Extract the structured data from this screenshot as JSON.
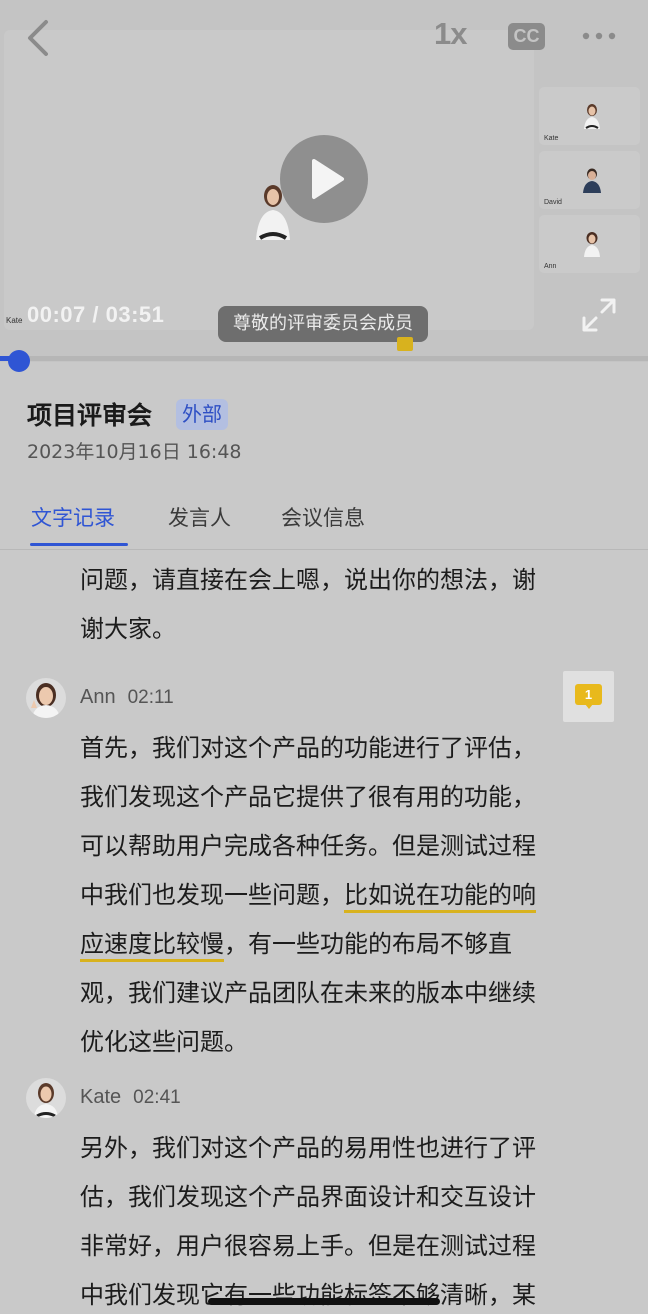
{
  "player": {
    "speed_label": "1x",
    "cc_label": "CC",
    "time_display": "00:07 / 03:51",
    "progress_fraction": 0.03,
    "caption_text": "尊敬的评审委员会成员",
    "stage_speaker_name": "Kate",
    "participant_thumbnails": [
      {
        "name": "Kate"
      },
      {
        "name": "David"
      },
      {
        "name": "Ann"
      }
    ],
    "accent_color": "#2f55d4"
  },
  "meeting": {
    "title": "项目评审会",
    "badge": "外部",
    "date": "2023年10月16日 16:48"
  },
  "tabs": [
    {
      "label": "文字记录",
      "active": true
    },
    {
      "label": "发言人",
      "active": false
    },
    {
      "label": "会议信息",
      "active": false
    }
  ],
  "transcript": {
    "prev_tail": [
      "问题，请直接在会上嗯，说出你的想法，谢",
      "谢大家。"
    ],
    "entries": [
      {
        "speaker": "Ann",
        "time": "02:11",
        "comment_count": "1",
        "lines": [
          "首先，我们对这个产品的功能进行了评估，",
          "我们发现这个产品它提供了很有用的功能，",
          "可以帮助用户完成各种任务。但是测试过程"
        ],
        "line4_pre": "中我们也发现一些问题，",
        "highlight_a": "比如说在功能的响",
        "highlight_b": "应速度比较慢",
        "line5_post": "，有一些功能的布局不够直",
        "lines_after": [
          "观，我们建议产品团队在未来的版本中继续",
          "优化这些问题。"
        ]
      },
      {
        "speaker": "Kate",
        "time": "02:41",
        "lines": [
          "另外，我们对这个产品的易用性也进行了评",
          "估，我们发现这个产品界面设计和交互设计",
          "非常好，用户很容易上手。但是在测试过程",
          "中我们发现它有一些功能标签不够清晰，某"
        ]
      }
    ],
    "highlight_color": "#d8b21e"
  }
}
